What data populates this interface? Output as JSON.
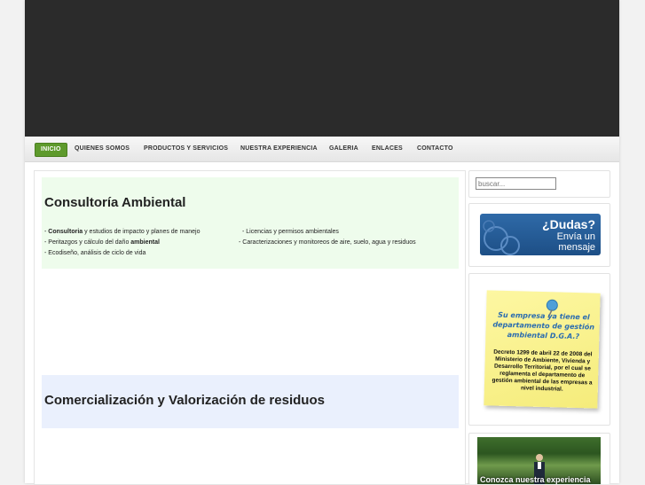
{
  "nav": {
    "items": [
      "INICIO",
      "QUIENES SOMOS",
      "PRODUCTOS Y SERVICIOS",
      "NUESTRA EXPERIENCIA",
      "GALERIA",
      "ENLACES",
      "CONTACTO"
    ]
  },
  "sections": {
    "consultoria": {
      "title": "Consultoría Ambiental",
      "line1_bold": "Consultoria",
      "line1_rest": " y estudios de impacto y planes de manejo",
      "line1_prefix": "- ",
      "line2_prefix": "- Peritazgos y cálculo del daño ",
      "line2_bold": "ambiental",
      "line3": "- Ecodiseño, análisis de ciclo de vida",
      "right1": "- Licencias y permisos ambientales",
      "right2": "- Caracterizaciones y monitoreos de aire, suelo, agua y residuos"
    },
    "comercializacion": {
      "title": "Comercialización y Valorización de residuos"
    }
  },
  "sidebar": {
    "search_placeholder": "buscar...",
    "dudas": {
      "line1": "¿Dudas?",
      "line2": "Envía un mensaje"
    },
    "note": {
      "title": "Su empresa ya tiene el departamento de gestión ambiental D.G.A.?",
      "body": "Decreto 1299 de abril 22 de 2008 del Ministerio de Ambiente, Vivienda y Desarrollo Territorial, por el cual se reglamenta el departamento de gestión ambiental de las empresas a nivel industrial."
    },
    "photo_caption": "Conozca nuestra experiencia"
  },
  "colors": {
    "header_bg": "#2b2b2b",
    "nav_active": "#5e9a2c",
    "consultoria_bg": "#eefcec",
    "comercializacion_bg": "#eaf0fd",
    "dudas_blue": "#1d4f86",
    "note_yellow": "#f5ec7b",
    "note_title_blue": "#2a6cb0"
  }
}
